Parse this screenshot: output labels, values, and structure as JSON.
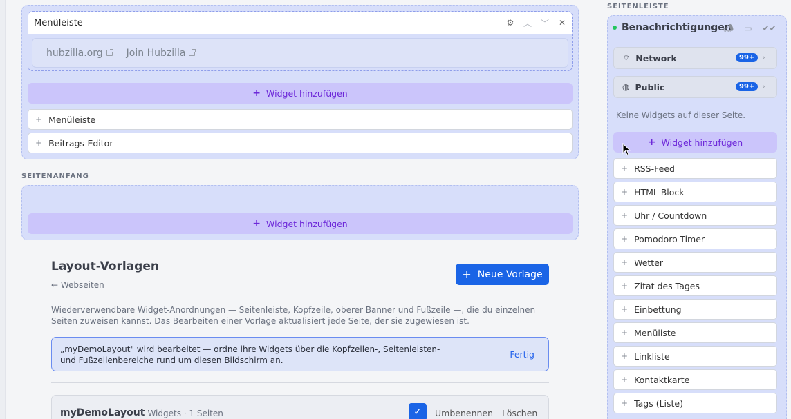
{
  "layout_editor": {
    "header_zone": {
      "menu_widget": {
        "title": "Menüleiste",
        "links": [
          {
            "label": "hubzilla.org"
          },
          {
            "label": "Join Hubzilla"
          }
        ]
      },
      "add_widget_label": "Widget hinzufügen",
      "palette": [
        "Menüleiste",
        "Beitrags-Editor"
      ]
    },
    "top_zone": {
      "label": "SEITENANFANG",
      "add_widget_label": "Widget hinzufügen"
    },
    "templates": {
      "title": "Layout-Vorlagen",
      "back_link": "← Webseiten",
      "new_button": "Neue Vorlage",
      "description": "Wiederverwendbare Widget-Anordnungen — Seitenleiste, Kopfzeile, oberer Banner und Fußzeile —, die du einzelnen Seiten zuweisen kannst. Das Bearbeiten einer Vorlage aktualisiert jede Seite, der sie zugewiesen ist.",
      "editing_notice": "„myDemoLayout\" wird bearbeitet — ordne ihre Widgets über die Kopfzeilen-, Seitenleisten- und Fußzeilenbereiche rund um diesen Bildschirm an.",
      "done_label": "Fertig",
      "items": [
        {
          "name": "myDemoLayout",
          "meta": "1 Widgets  · 1 Seiten",
          "rename": "Umbenennen",
          "delete": "Löschen"
        }
      ]
    }
  },
  "sidebar": {
    "label": "SEITENLEISTE",
    "notifications": {
      "title": "Benachrichtigungen",
      "rows": [
        {
          "label": "Network",
          "badge": "99+",
          "icon": "wifi-icon"
        },
        {
          "label": "Public",
          "badge": "99+",
          "icon": "globe-icon"
        }
      ],
      "empty_text": "Keine Widgets auf dieser Seite."
    },
    "add_widget_label": "Widget hinzufügen",
    "palette": [
      "RSS-Feed",
      "HTML-Block",
      "Uhr / Countdown",
      "Pomodoro-Timer",
      "Wetter",
      "Zitat des Tages",
      "Einbettung",
      "Menüliste",
      "Linkliste",
      "Kontaktkarte",
      "Tags (Liste)"
    ]
  },
  "colors": {
    "zone_bg": "#d7defa",
    "add_widget_bg": "#cbc5fb",
    "add_widget_text": "#6d28d9",
    "primary": "#1a64e6",
    "online_dot": "#22c55e"
  }
}
